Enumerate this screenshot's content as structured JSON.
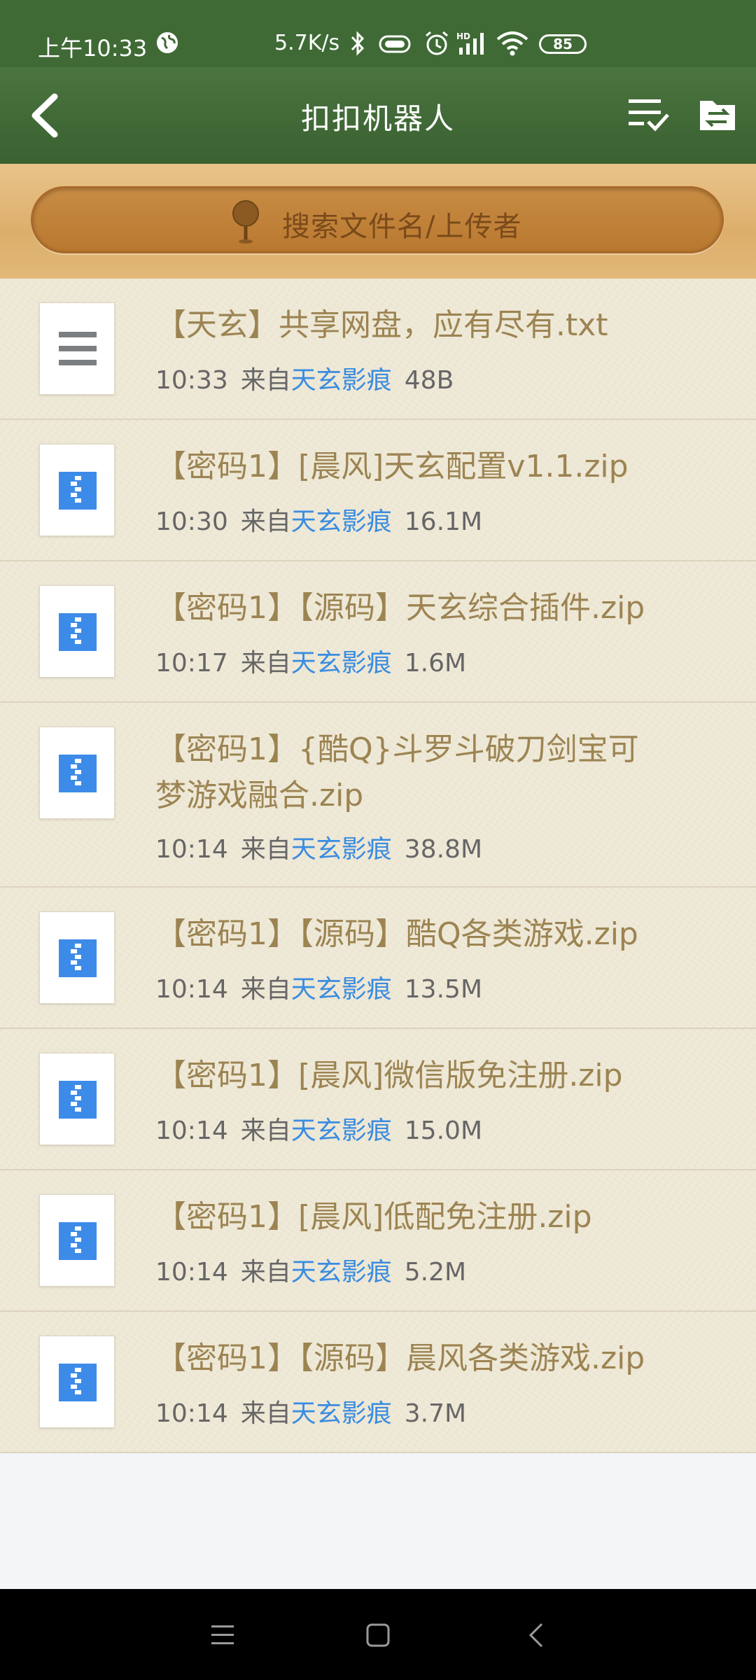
{
  "status_bar": {
    "time": "上午10:33",
    "net_speed": "5.7K/s",
    "battery": "85"
  },
  "header": {
    "title": "扣扣机器人",
    "icons": [
      "back-icon",
      "multi-select-icon",
      "folder-upload-icon"
    ]
  },
  "search": {
    "placeholder": "搜索文件名/上传者"
  },
  "files": [
    {
      "name": "【天玄】共享网盘，应有尽有.txt",
      "time": "10:33",
      "from_label": "来自",
      "uploader": "天玄影痕",
      "size": "48B",
      "type": "txt"
    },
    {
      "name": "【密码1】[晨风]天玄配置v1.1.zip",
      "time": "10:30",
      "from_label": "来自",
      "uploader": "天玄影痕",
      "size": "16.1M",
      "type": "zip"
    },
    {
      "name": "【密码1】【源码】天玄综合插件.zip",
      "time": "10:17",
      "from_label": "来自",
      "uploader": "天玄影痕",
      "size": "1.6M",
      "type": "zip"
    },
    {
      "name": "【密码1】{酷Q}斗罗斗破刀剑宝可梦游戏融合.zip",
      "time": "10:14",
      "from_label": "来自",
      "uploader": "天玄影痕",
      "size": "38.8M",
      "type": "zip"
    },
    {
      "name": "【密码1】【源码】酷Q各类游戏.zip",
      "time": "10:14",
      "from_label": "来自",
      "uploader": "天玄影痕",
      "size": "13.5M",
      "type": "zip"
    },
    {
      "name": "【密码1】[晨风]微信版免注册.zip",
      "time": "10:14",
      "from_label": "来自",
      "uploader": "天玄影痕",
      "size": "15.0M",
      "type": "zip"
    },
    {
      "name": "【密码1】[晨风]低配免注册.zip",
      "time": "10:14",
      "from_label": "来自",
      "uploader": "天玄影痕",
      "size": "5.2M",
      "type": "zip"
    },
    {
      "name": "【密码1】【源码】晨风各类游戏.zip",
      "time": "10:14",
      "from_label": "来自",
      "uploader": "天玄影痕",
      "size": "3.7M",
      "type": "zip"
    }
  ],
  "colors": {
    "header_green": "#3f6a35",
    "file_name": "#9c8452",
    "uploader_link": "#3a8ce0",
    "zip_icon": "#3d8be8"
  }
}
